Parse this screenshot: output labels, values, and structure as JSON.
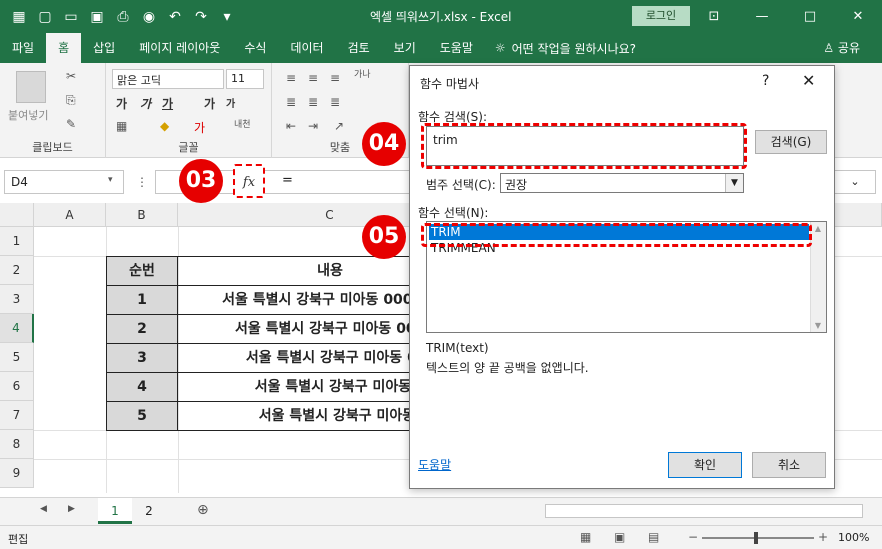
{
  "window": {
    "title": "엑셀 띄워쓰기.xlsx  -  Excel",
    "login": "로그인"
  },
  "tabs": [
    "파일",
    "홈",
    "삽입",
    "페이지 레이아웃",
    "수식",
    "데이터",
    "검토",
    "보기",
    "도움말"
  ],
  "tell_me": "어떤 작업을 원하시나요?",
  "share": "공유",
  "ribbon": {
    "paste": "붙여넣기",
    "clipboard": "클립보드",
    "font_name": "맑은 고딕",
    "font_size": "11",
    "font_group": "글꼴",
    "align_group": "맞춤"
  },
  "formula_bar": {
    "name_box": "D4",
    "fx": "fx",
    "value": "="
  },
  "columns": [
    "A",
    "B",
    "C"
  ],
  "rows": [
    "1",
    "2",
    "3",
    "4",
    "5",
    "6",
    "7",
    "8",
    "9"
  ],
  "table": {
    "header_num": "순번",
    "header_content": "내용",
    "rows": [
      {
        "n": "1",
        "text": "서울 특별시 강북구 미아동 000-00"
      },
      {
        "n": "2",
        "text": "서울 특별시 강북구 미아동 000-0"
      },
      {
        "n": "3",
        "text": "서울 특별시 강북구 미아동 000-"
      },
      {
        "n": "4",
        "text": "서울 특별시 강북구 미아동 000"
      },
      {
        "n": "5",
        "text": "서울 특별시 강북구 미아동 000"
      }
    ]
  },
  "sheets": [
    "1",
    "2"
  ],
  "status": {
    "mode": "편집",
    "zoom": "100%"
  },
  "dialog": {
    "title": "함수 마법사",
    "help": "?",
    "search_label": "함수 검색(S):",
    "search_value": "trim",
    "search_button": "검색(G)",
    "category_label": "범주 선택(C):",
    "category_value": "권장",
    "select_label": "함수 선택(N):",
    "functions": [
      "TRIM",
      "TRIMMEAN"
    ],
    "signature": "TRIM(text)",
    "description": "텍스트의 양 끝 공백을 없앱니다.",
    "help_link": "도움말",
    "ok": "확인",
    "cancel": "취소"
  },
  "annotations": {
    "step3": "03",
    "step4": "04",
    "step5": "05"
  },
  "colors": {
    "accent": "#217346",
    "highlight": "#e00000",
    "selection": "#0078d7"
  }
}
